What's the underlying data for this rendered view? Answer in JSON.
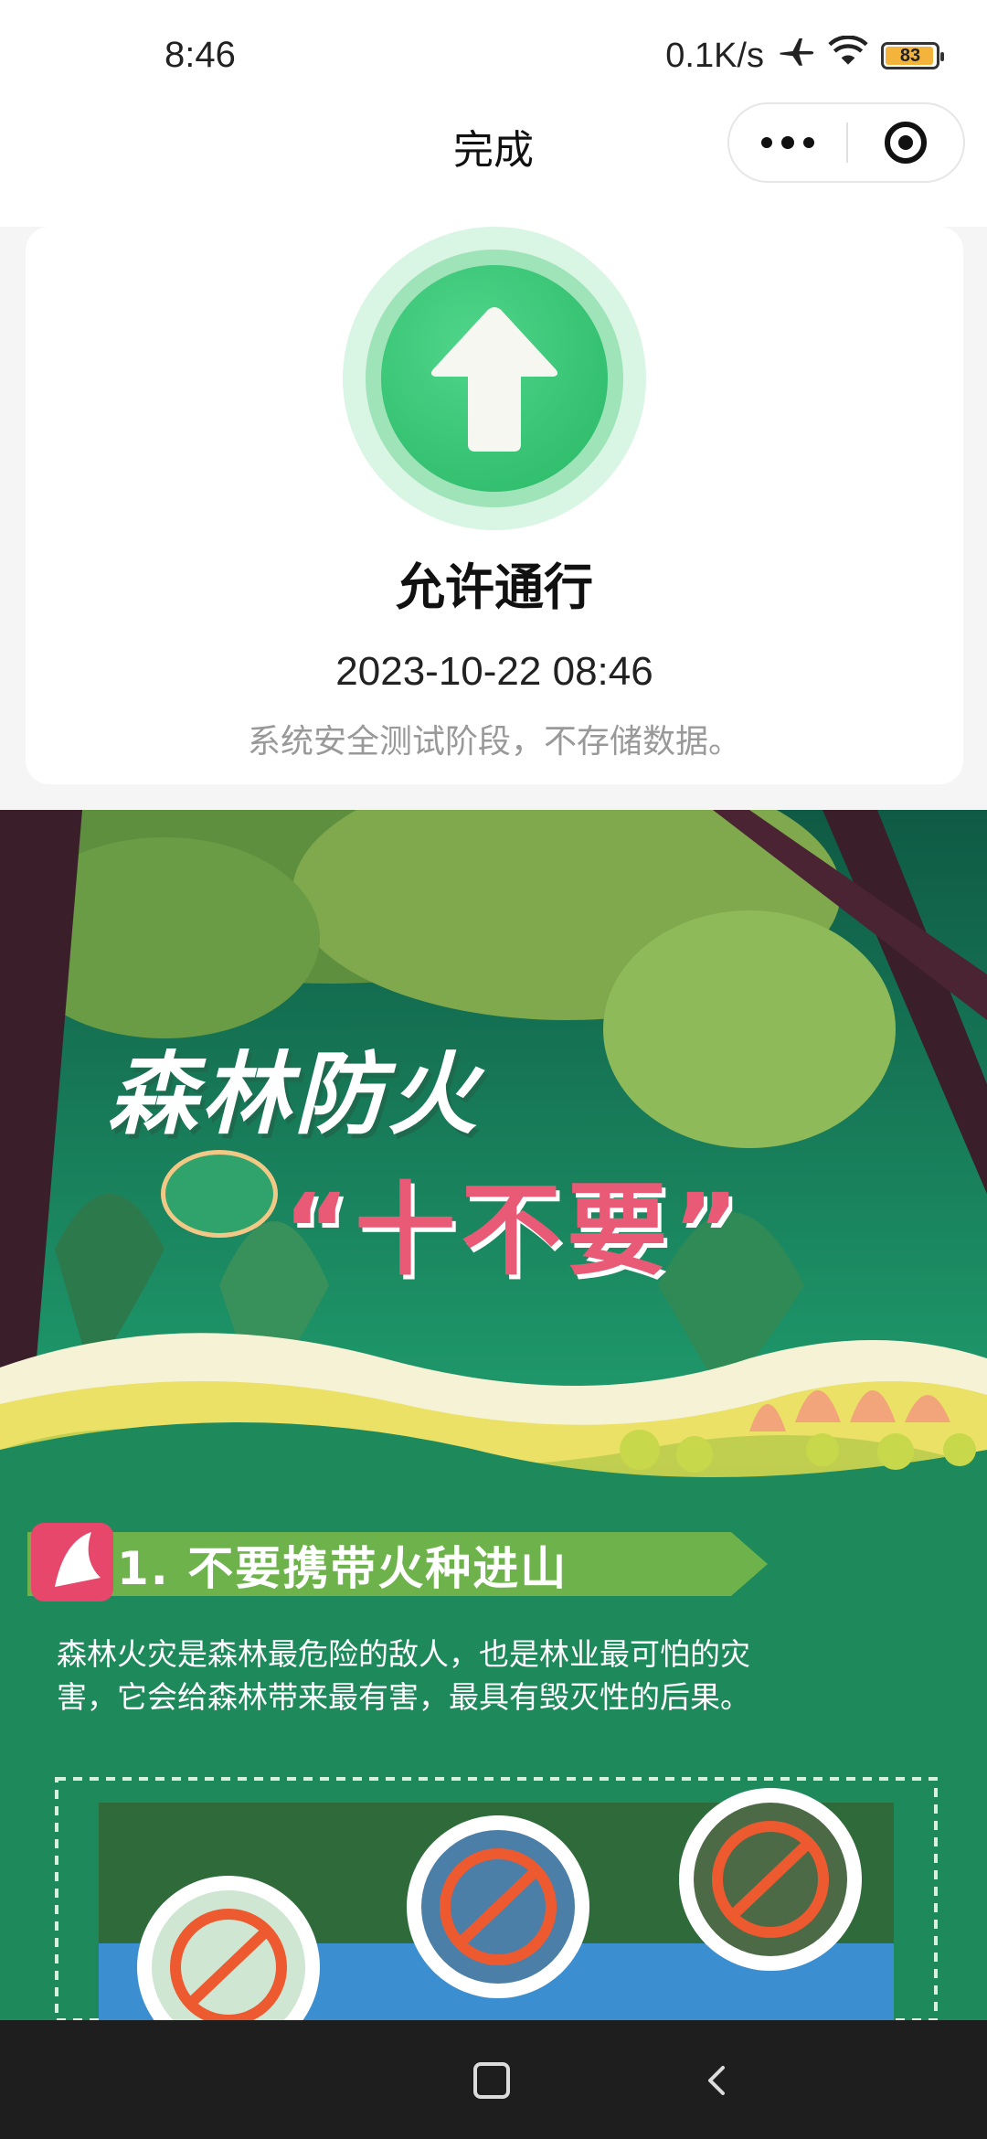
{
  "status_bar": {
    "time": "8:46",
    "network_speed": "0.1K/s",
    "battery_level": "83",
    "icons": [
      "airplane-icon",
      "wifi-icon",
      "battery-icon"
    ]
  },
  "nav": {
    "title": "完成",
    "more_icon": "more-dots-icon",
    "close_icon": "target-close-icon"
  },
  "result_card": {
    "icon": "up-arrow-icon",
    "title": "允许通行",
    "datetime": "2023-10-22 08:46",
    "note": "系统安全测试阶段，不存储数据。",
    "accent_color": "#2fbf6f"
  },
  "poster": {
    "title": "森林防火",
    "subtitle": "“十不要”",
    "section_heading": "1. 不要携带火种进山",
    "section_body": "森林火灾是森林最危险的敌人，也是林业最可怕的灾害，它会给森林带来最有害，最具有毁灭性的后果。",
    "colors": {
      "background": "#1d8a5c",
      "title": "#ffffff",
      "subtitle": "#e85a76"
    }
  },
  "system_nav": {
    "home_icon": "square-home-icon",
    "back_icon": "chevron-back-icon"
  }
}
